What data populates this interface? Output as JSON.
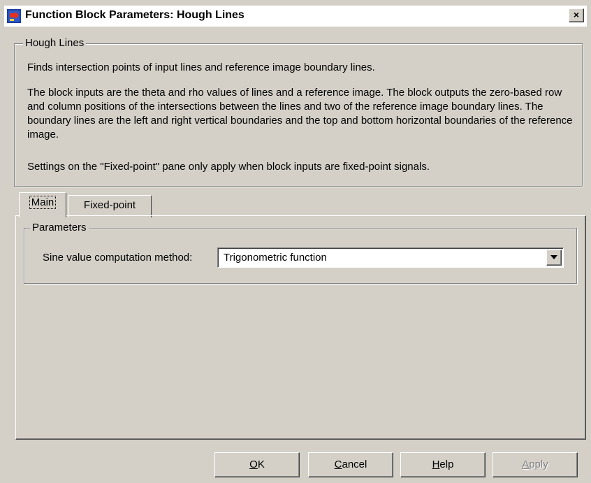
{
  "window": {
    "title": "Function Block Parameters: Hough Lines",
    "close_label": "×"
  },
  "description": {
    "group_title": "Hough Lines",
    "paragraph1": "Finds intersection points of input lines and reference image boundary lines.",
    "paragraph2": "The block inputs are the theta and rho values of lines and a reference image. The block outputs the zero-based row and column positions of the intersections between the lines and two of the reference image boundary lines. The boundary lines are the left and right vertical boundaries and the top and bottom horizontal boundaries of the reference image.",
    "paragraph3": "Settings on the \"Fixed-point\" pane only apply when block inputs are fixed-point signals."
  },
  "tabs": [
    {
      "label": "Main",
      "active": true
    },
    {
      "label": "Fixed-point",
      "active": false
    }
  ],
  "parameters": {
    "group_title": "Parameters",
    "sine_method_label": "Sine value computation method:",
    "sine_method_value": "Trigonometric function"
  },
  "buttons": {
    "ok_first": "O",
    "ok_rest": "K",
    "cancel_first": "C",
    "cancel_rest": "ancel",
    "help_first": "H",
    "help_rest": "elp",
    "apply_first": "A",
    "apply_rest": "pply"
  },
  "colors": {
    "dialog_bg": "#d4d0c8",
    "title_bg": "#ffffff",
    "disabled_text": "#808080"
  },
  "icons": {
    "app": "simulink-block-icon",
    "close": "close-icon",
    "dropdown": "chevron-down-icon"
  }
}
